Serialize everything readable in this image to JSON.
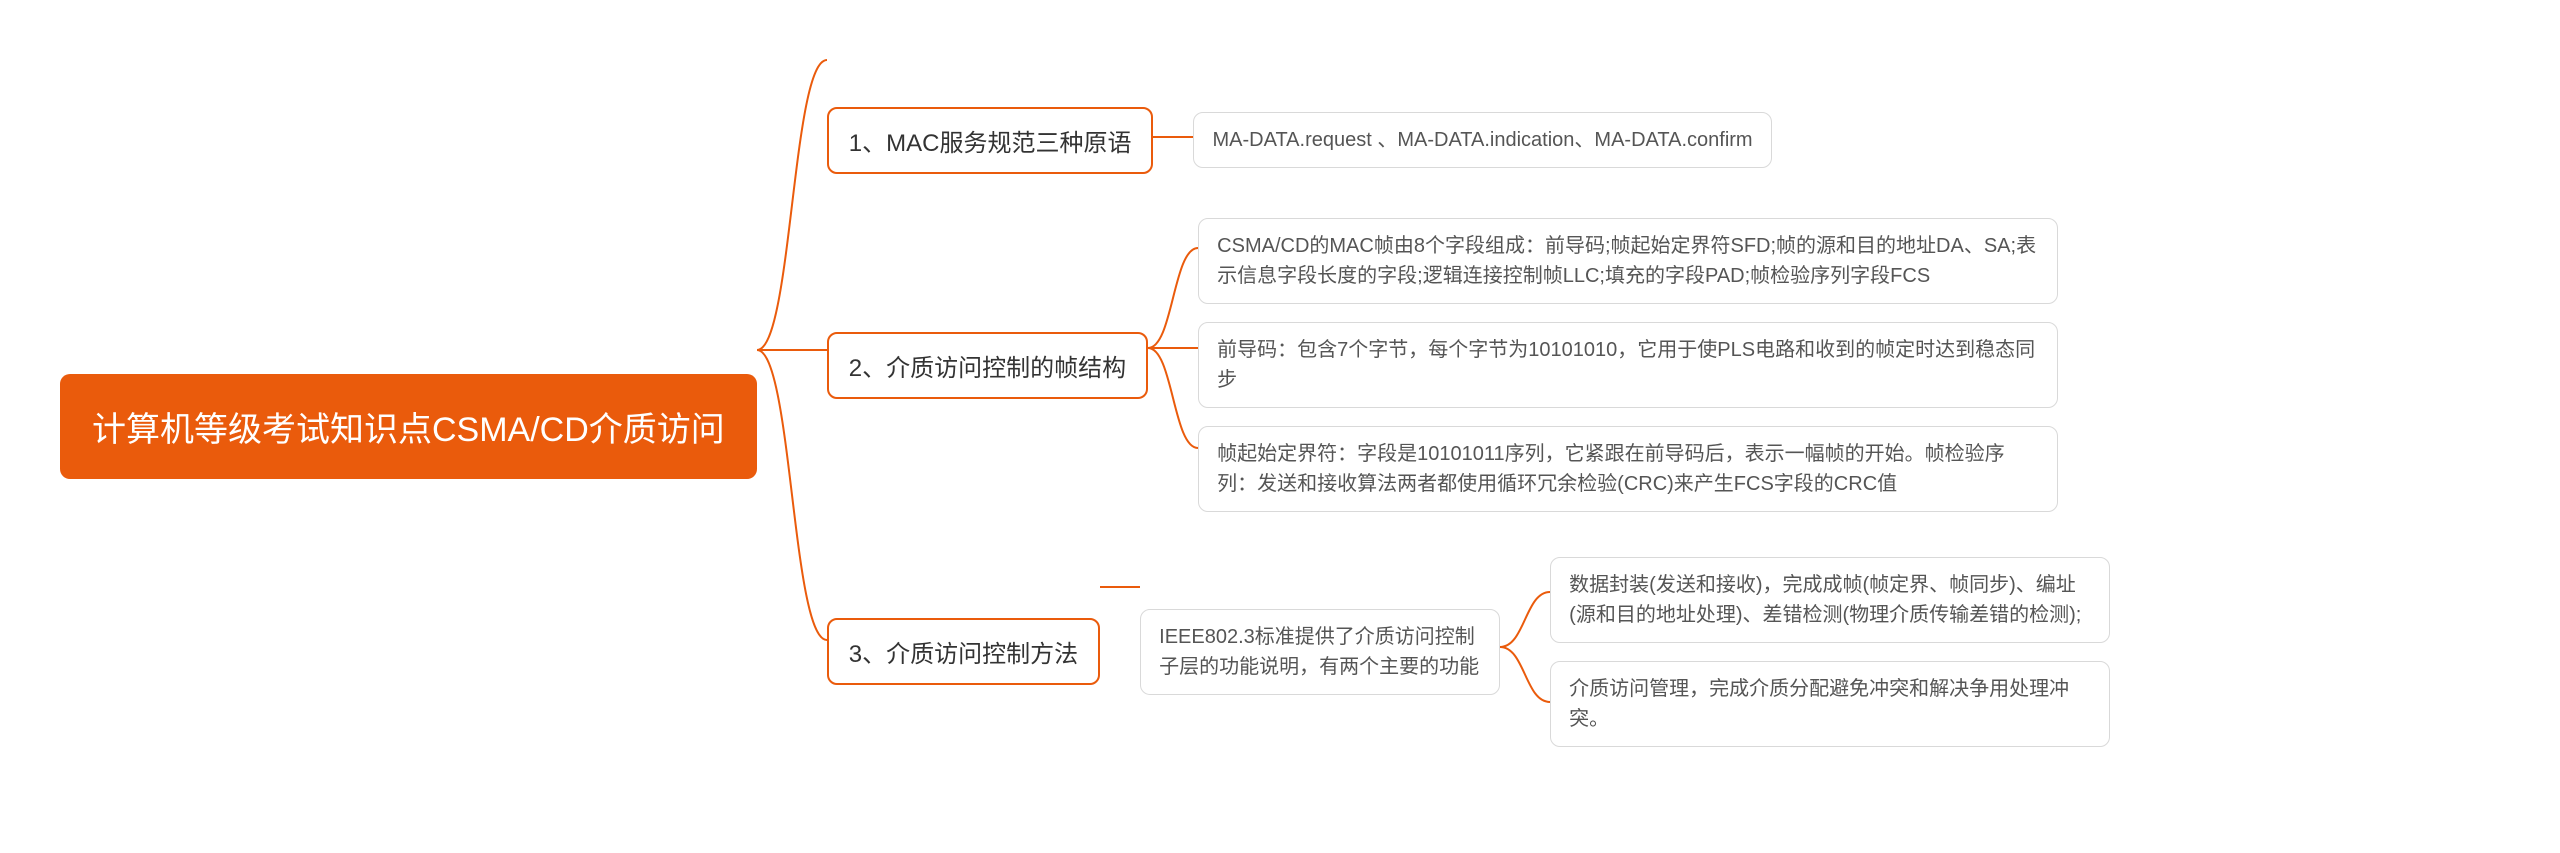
{
  "root": "计算机等级考试知识点CSMA/CD介质访问",
  "branches": [
    {
      "title": "1、MAC服务规范三种原语",
      "children": [
        {
          "text": "MA-DATA.request 、MA-DATA.indication、MA-DATA.confirm"
        }
      ]
    },
    {
      "title": "2、介质访问控制的帧结构",
      "children": [
        {
          "text": "CSMA/CD的MAC帧由8个字段组成：前导码;帧起始定界符SFD;帧的源和目的地址DA、SA;表示信息字段长度的字段;逻辑连接控制帧LLC;填充的字段PAD;帧检验序列字段FCS"
        },
        {
          "text": "前导码：包含7个字节，每个字节为10101010，它用于使PLS电路和收到的帧定时达到稳态同步"
        },
        {
          "text": "帧起始定界符：字段是10101011序列，它紧跟在前导码后，表示一幅帧的开始。帧检验序列：发送和接收算法两者都使用循环冗余检验(CRC)来产生FCS字段的CRC值"
        }
      ]
    },
    {
      "title": "3、介质访问控制方法",
      "mid": "IEEE802.3标准提供了介质访问控制子层的功能说明，有两个主要的功能",
      "children": [
        {
          "text": "数据封装(发送和接收)，完成成帧(帧定界、帧同步)、编址(源和目的地址处理)、差错检测(物理介质传输差错的检测);"
        },
        {
          "text": "介质访问管理，完成介质分配避免冲突和解决争用处理冲突。"
        }
      ]
    }
  ],
  "colors": {
    "accent": "#ea5b0c",
    "leafBorder": "#d9d9d9"
  }
}
